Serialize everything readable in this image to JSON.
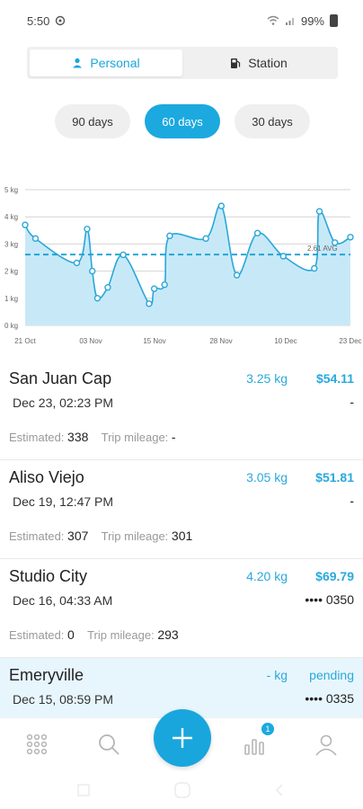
{
  "status_bar": {
    "time": "5:50",
    "battery": "99%"
  },
  "tabs": [
    {
      "label": "Personal",
      "active": true,
      "icon": "person-icon"
    },
    {
      "label": "Station",
      "active": false,
      "icon": "fuel-pump-icon"
    }
  ],
  "ranges": [
    {
      "label": "90 days",
      "active": false
    },
    {
      "label": "60 days",
      "active": true
    },
    {
      "label": "30 days",
      "active": false
    }
  ],
  "chart_data": {
    "type": "area",
    "y_ticks": [
      "5 kg",
      "4 kg",
      "3 kg",
      "2 kg",
      "1 kg",
      "0 kg"
    ],
    "x_ticks": [
      "21 Oct",
      "03 Nov",
      "15 Nov",
      "28 Nov",
      "10 Dec",
      "23 Dec"
    ],
    "ylim": [
      0,
      5
    ],
    "avg_value": 2.61,
    "avg_label": "2.61 AVG",
    "points": [
      {
        "x": "2023-10-21",
        "y": 3.7
      },
      {
        "x": "2023-10-23",
        "y": 3.2
      },
      {
        "x": "2023-10-31",
        "y": 2.3
      },
      {
        "x": "2023-11-02",
        "y": 3.55
      },
      {
        "x": "2023-11-03",
        "y": 2.0
      },
      {
        "x": "2023-11-04",
        "y": 1.0
      },
      {
        "x": "2023-11-06",
        "y": 1.4
      },
      {
        "x": "2023-11-09",
        "y": 2.6
      },
      {
        "x": "2023-11-14",
        "y": 0.8
      },
      {
        "x": "2023-11-15",
        "y": 1.35
      },
      {
        "x": "2023-11-17",
        "y": 1.5
      },
      {
        "x": "2023-11-18",
        "y": 3.3
      },
      {
        "x": "2023-11-25",
        "y": 3.2
      },
      {
        "x": "2023-11-28",
        "y": 4.4
      },
      {
        "x": "2023-12-01",
        "y": 1.85
      },
      {
        "x": "2023-12-05",
        "y": 3.4
      },
      {
        "x": "2023-12-10",
        "y": 2.55
      },
      {
        "x": "2023-12-16",
        "y": 2.1
      },
      {
        "x": "2023-12-17",
        "y": 4.2
      },
      {
        "x": "2023-12-20",
        "y": 3.05
      },
      {
        "x": "2023-12-23",
        "y": 3.25
      }
    ],
    "colors": {
      "line": "#2aa7d9",
      "fill": "#c7e9f7",
      "avg": "#1aa0d6"
    }
  },
  "trips": [
    {
      "name": "San Juan Cap",
      "date": "Dec 23, 02:23 PM",
      "kg": "3.25 kg",
      "price": "$54.11",
      "right2": "-",
      "estimated_label": "Estimated:",
      "estimated": "338",
      "mileage_label": "Trip mileage:",
      "mileage": "-",
      "highlight": false
    },
    {
      "name": "Aliso Viejo",
      "date": "Dec 19, 12:47 PM",
      "kg": "3.05 kg",
      "price": "$51.81",
      "right2": "-",
      "estimated_label": "Estimated:",
      "estimated": "307",
      "mileage_label": "Trip mileage:",
      "mileage": "301",
      "highlight": false
    },
    {
      "name": "Studio City",
      "date": "Dec 16, 04:33 AM",
      "kg": "4.20 kg",
      "price": "$69.79",
      "right2": "•••• 0350",
      "estimated_label": "Estimated:",
      "estimated": "0",
      "mileage_label": "Trip mileage:",
      "mileage": "293",
      "highlight": false
    },
    {
      "name": "Emeryville",
      "date": "Dec 15, 08:59 PM",
      "kg": "- kg",
      "price": "pending",
      "right2": "•••• 0335",
      "highlight": true
    }
  ],
  "nav": {
    "badge": "1",
    "items": [
      "grid-icon",
      "search-icon",
      "add-icon",
      "stats-icon",
      "profile-icon"
    ]
  }
}
